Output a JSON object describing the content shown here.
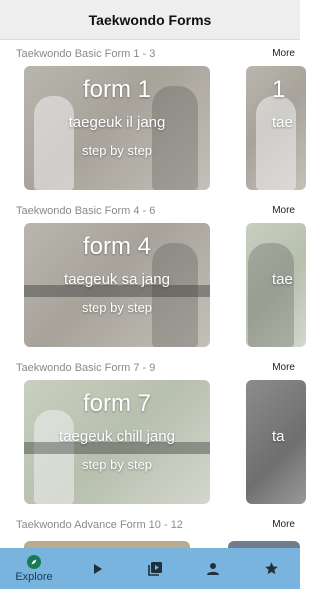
{
  "header": {
    "title": "Taekwondo Forms"
  },
  "more_label": "More",
  "sections": [
    {
      "title": "Taekwondo Basic Form 1 - 3",
      "card": {
        "title": "form 1",
        "subtitle": "taegeuk il jang",
        "tagline": "step by step"
      },
      "peek": {
        "title": "1",
        "subtitle": "tae"
      }
    },
    {
      "title": "Taekwondo Basic Form 4 - 6",
      "card": {
        "title": "form 4",
        "subtitle": "taegeuk sa jang",
        "tagline": "step by step"
      },
      "peek": {
        "title": "",
        "subtitle": "tae"
      }
    },
    {
      "title": "Taekwondo Basic Form 7 - 9",
      "card": {
        "title": "form 7",
        "subtitle": "taegeuk chill jang",
        "tagline": "step by step"
      },
      "peek": {
        "title": "",
        "subtitle": "ta"
      }
    },
    {
      "title": "Taekwondo Advance Form 10 - 12"
    }
  ],
  "nav": {
    "explore_label": "Explore",
    "icons": [
      "compass-icon",
      "play-icon",
      "library-icon",
      "person-icon",
      "star-icon"
    ],
    "background": "#78b4de"
  }
}
